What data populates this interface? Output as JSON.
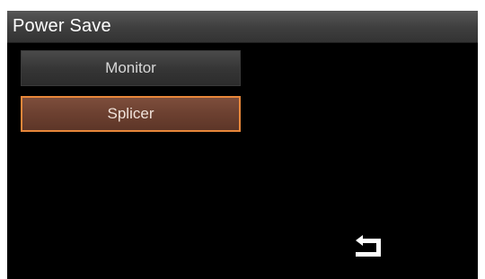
{
  "header": {
    "title": "Power Save"
  },
  "menu": {
    "items": [
      {
        "label": "Monitor",
        "selected": false
      },
      {
        "label": "Splicer",
        "selected": true
      }
    ]
  },
  "footer": {
    "back_icon": "return-arrow-icon"
  },
  "colors": {
    "background": "#000000",
    "title_bar": "#444444",
    "button": "#3a3a3a",
    "selected_button": "#6c4030",
    "selected_border": "#e8873a"
  }
}
